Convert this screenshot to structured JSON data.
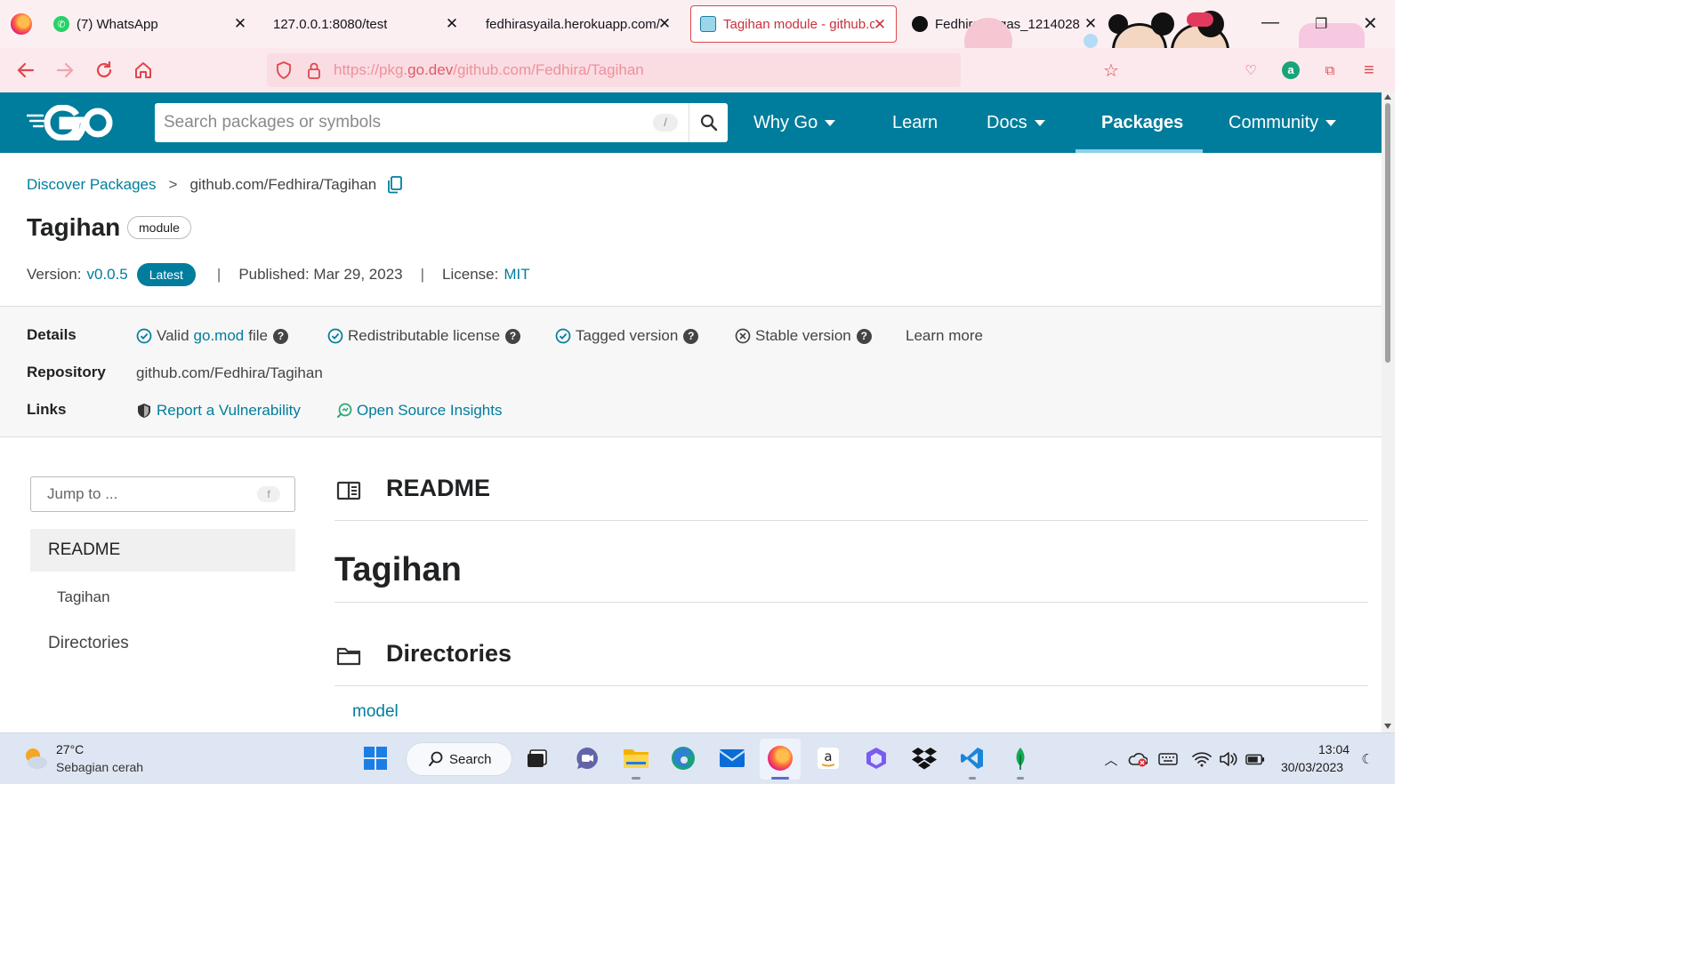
{
  "browser": {
    "tabs": [
      {
        "title": "(7) WhatsApp",
        "icon": "whatsapp-icon",
        "active": false
      },
      {
        "title": "127.0.0.1:8080/test",
        "icon": "none",
        "active": false
      },
      {
        "title": "fedhirasyaila.herokuapp.com/t",
        "icon": "none",
        "active": false
      },
      {
        "title": "Tagihan module - github.c",
        "icon": "gopher-icon",
        "active": true
      },
      {
        "title": "Fedhira/Tugas_1214028",
        "icon": "github-icon",
        "active": false
      }
    ],
    "url_prefix": "https://pkg.",
    "url_domain": "go.dev",
    "url_path": "/github.com/Fedhira/Tagihan"
  },
  "site": {
    "search_placeholder": "Search packages or symbols",
    "search_shortcut": "/",
    "nav": {
      "why_go": "Why Go",
      "learn": "Learn",
      "docs": "Docs",
      "packages": "Packages",
      "community": "Community"
    },
    "accent_color": "#007d9c"
  },
  "page": {
    "breadcrumb_root": "Discover Packages",
    "breadcrumb_sep": ">",
    "breadcrumb_current": "github.com/Fedhira/Tagihan",
    "title": "Tagihan",
    "badge": "module",
    "meta": {
      "version_label": "Version:",
      "version": "v0.0.5",
      "latest_badge": "Latest",
      "pipe": "|",
      "published": "Published: Mar 29, 2023",
      "license_label": "License:",
      "license": "MIT"
    },
    "details": {
      "details_label": "Details",
      "checks": [
        {
          "text": "Valid ",
          "link": "go.mod",
          "after": " file",
          "status": "ok"
        },
        {
          "text": "Redistributable license",
          "status": "ok"
        },
        {
          "text": "Tagged version",
          "status": "ok"
        },
        {
          "text": "Stable version",
          "status": "fail"
        }
      ],
      "help_glyph": "?",
      "learn_more": "Learn more",
      "repository_label": "Repository",
      "repository": "github.com/Fedhira/Tagihan",
      "links_label": "Links",
      "report_vuln": "Report a Vulnerability",
      "osi": "Open Source Insights"
    },
    "sidebar": {
      "jump_placeholder": "Jump to ...",
      "jump_key": "f",
      "items": [
        "README",
        "Tagihan",
        "Directories"
      ]
    },
    "main": {
      "readme_heading": "README",
      "readme_title": "Tagihan",
      "directories_heading": "Directories",
      "dir_first": "model"
    }
  },
  "taskbar": {
    "temperature": "27°C",
    "weather": "Sebagian cerah",
    "search_label": "Search",
    "time": "13:04",
    "date": "30/03/2023"
  }
}
